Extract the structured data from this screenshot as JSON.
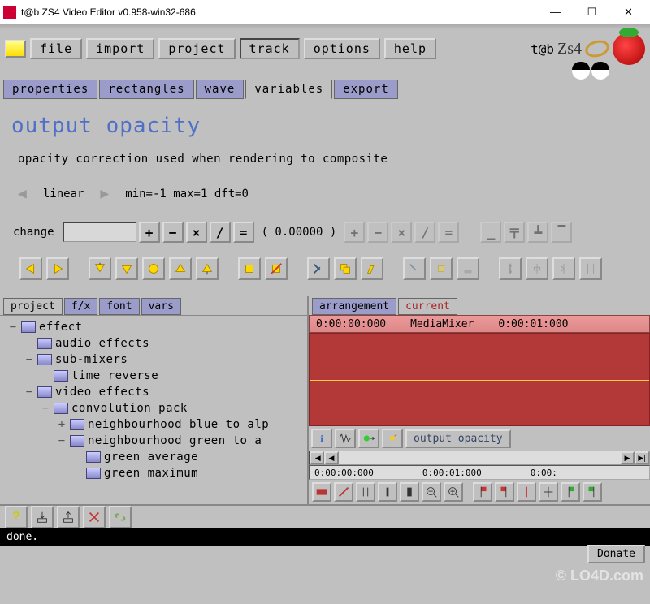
{
  "window": {
    "title": "t@b ZS4 Video Editor v0.958-win32-686"
  },
  "menu": {
    "items": [
      "file",
      "import",
      "project",
      "track",
      "options",
      "help"
    ],
    "active_index": 3,
    "logo_text": "t@b",
    "logo_script": "Zs4"
  },
  "tabs": {
    "items": [
      "properties",
      "rectangles",
      "wave",
      "variables",
      "export"
    ],
    "active_index": 3
  },
  "variables_panel": {
    "heading": "output opacity",
    "description": "opacity correction used when rendering to composite",
    "mode": "linear",
    "range": "min=-1  max=1  dft=0",
    "change_label": "change",
    "value": "( 0.00000  )",
    "ops": [
      "+",
      "−",
      "×",
      "∕",
      "="
    ],
    "disabled_ops": [
      "+",
      "−",
      "×",
      "∕",
      "="
    ]
  },
  "left_panel": {
    "tabs": [
      "project",
      "f/x",
      "font",
      "vars"
    ],
    "active_index": 0,
    "tree": [
      {
        "indent": 1,
        "exp": "−",
        "label": "effect"
      },
      {
        "indent": 2,
        "exp": "",
        "label": "audio effects"
      },
      {
        "indent": 2,
        "exp": "−",
        "label": "sub-mixers"
      },
      {
        "indent": 3,
        "exp": "",
        "label": "time reverse"
      },
      {
        "indent": 2,
        "exp": "−",
        "label": "video effects"
      },
      {
        "indent": 3,
        "exp": "−",
        "label": "convolution pack"
      },
      {
        "indent": 4,
        "exp": "+",
        "label": "neighbourhood blue to alp"
      },
      {
        "indent": 4,
        "exp": "−",
        "label": "neighbourhood green to a"
      },
      {
        "indent": 5,
        "exp": "",
        "label": "green average"
      },
      {
        "indent": 5,
        "exp": "",
        "label": "green maximum"
      }
    ]
  },
  "right_panel": {
    "tabs": [
      "arrangement",
      "current"
    ],
    "active_index": 1,
    "time_start": "0:00:00:000",
    "track_name": "MediaMixer",
    "time_end": "0:00:01:000",
    "output_label": "output opacity",
    "ruler": [
      "0:00:00:000",
      "0:00:01:000",
      "0:00:"
    ]
  },
  "status": {
    "text": "done.",
    "donate": "Donate",
    "watermark": "© LO4D.com"
  }
}
